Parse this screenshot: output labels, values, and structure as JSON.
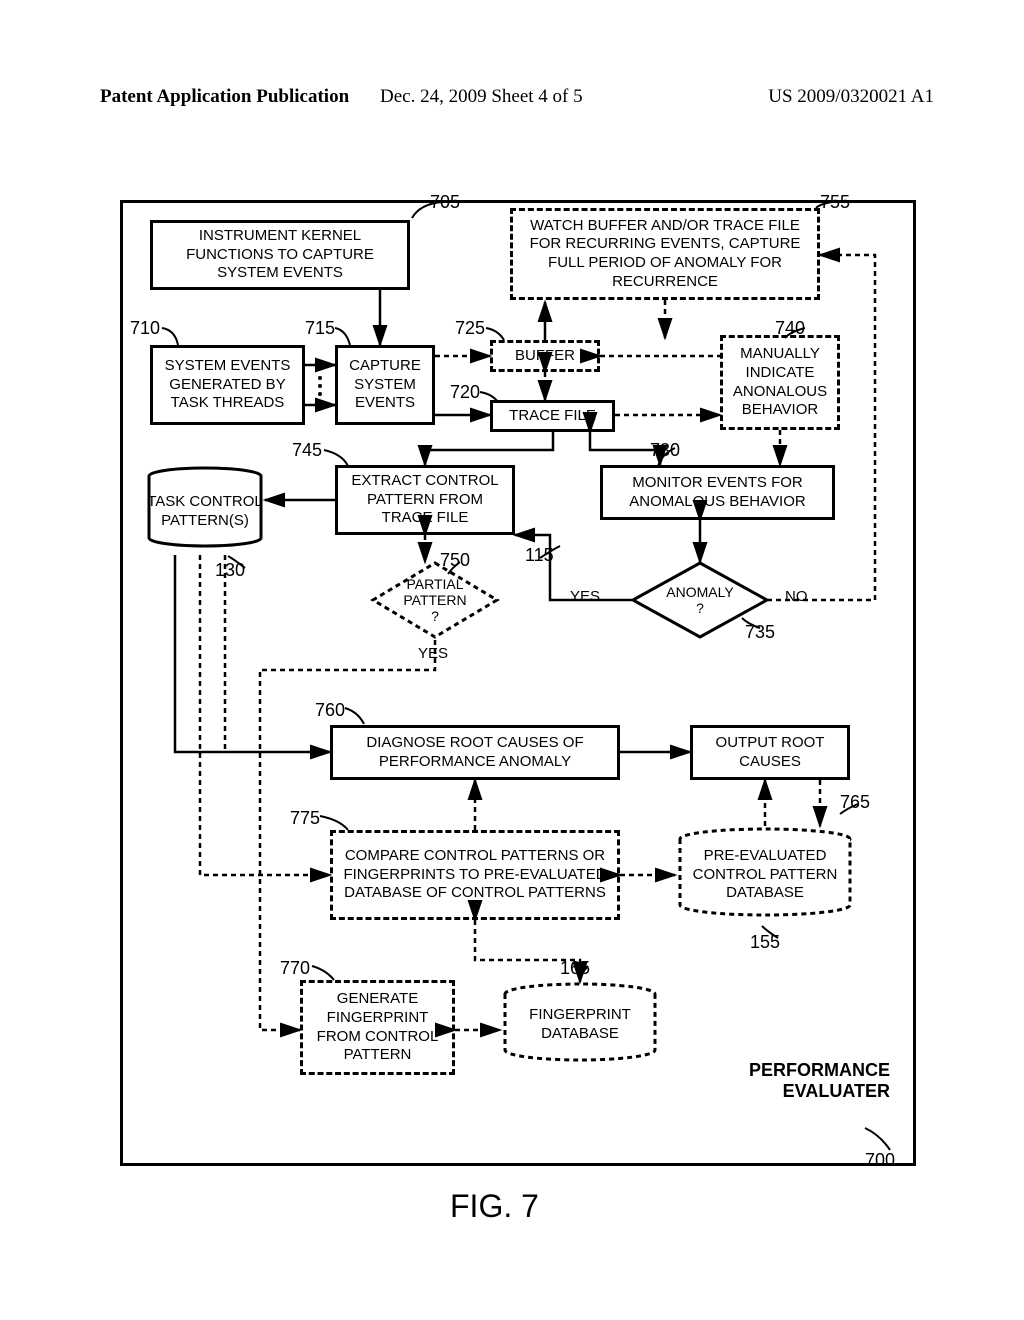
{
  "header": {
    "left": "Patent Application Publication",
    "mid": "Dec. 24, 2009  Sheet 4 of 5",
    "right": "US 2009/0320021 A1"
  },
  "figure_label": "FIG. 7",
  "system_title": "PERFORMANCE\nEVALUATER",
  "refs": {
    "r700": "700",
    "r705": "705",
    "r710": "710",
    "r715": "715",
    "r720": "720",
    "r725": "725",
    "r730": "730",
    "r735": "735",
    "r740": "740",
    "r745": "745",
    "r750": "750",
    "r755": "755",
    "r760": "760",
    "r765": "765",
    "r770": "770",
    "r775": "775",
    "r115": "115",
    "r130": "130",
    "r155": "155",
    "r165": "165"
  },
  "boxes": {
    "b705": "INSTRUMENT KERNEL FUNCTIONS TO CAPTURE SYSTEM EVENTS",
    "b710": "SYSTEM EVENTS GENERATED BY TASK THREADS",
    "b715": "CAPTURE SYSTEM EVENTS",
    "b725": "BUFFER",
    "b720": "TRACE FILE",
    "b740": "MANUALLY INDICATE ANONALOUS BEHAVIOR",
    "b755": "WATCH BUFFER AND/OR TRACE FILE FOR RECURRING EVENTS, CAPTURE FULL PERIOD OF ANOMALY FOR RECURRENCE",
    "b745": "EXTRACT CONTROL PATTERN FROM TRACE FILE",
    "b730": "MONITOR EVENTS FOR ANOMALOUS BEHAVIOR",
    "b760": "DIAGNOSE ROOT CAUSES OF PERFORMANCE ANOMALY",
    "b765": "OUTPUT ROOT CAUSES",
    "b775": "COMPARE CONTROL PATTERNS OR FINGERPRINTS TO PRE-EVALUATED DATABASE OF CONTROL PATTERNS",
    "b770": "GENERATE FINGERPRINT FROM CONTROL PATTERN"
  },
  "cyls": {
    "c130": "TASK CONTROL PATTERN(S)",
    "c155": "PRE-EVALUATED CONTROL PATTERN DATABASE",
    "c165": "FINGERPRINT DATABASE"
  },
  "diamonds": {
    "d735": "ANOMALY\n?",
    "d750": "PARTIAL\nPATTERN\n?"
  },
  "labels": {
    "yes1": "YES",
    "yes2": "YES",
    "no": "NO"
  }
}
